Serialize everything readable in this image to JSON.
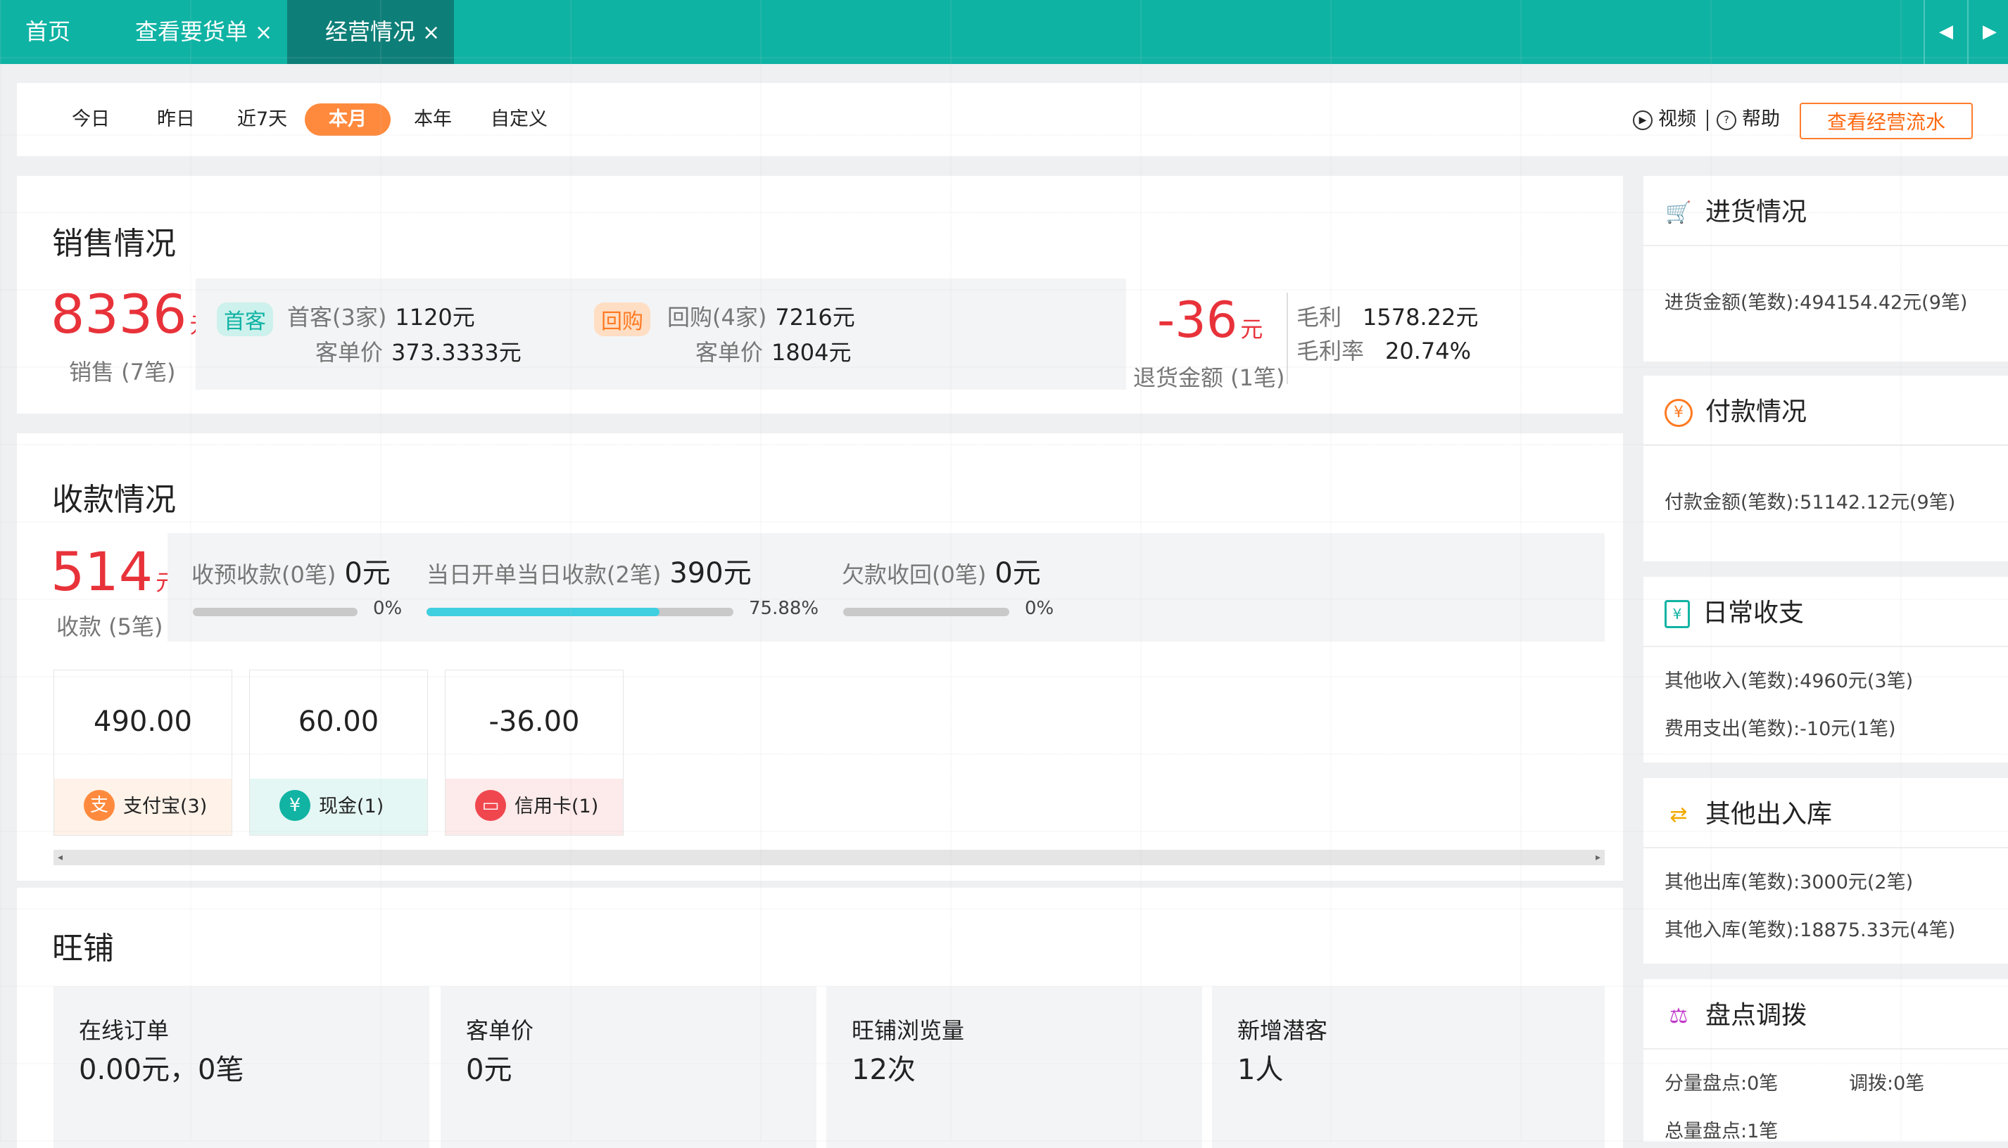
{
  "tabs": [
    {
      "label": "首页",
      "closable": false
    },
    {
      "label": "查看要货单",
      "closable": true
    },
    {
      "label": "经营情况",
      "closable": true,
      "active": true
    }
  ],
  "tab_close_glyph": "×",
  "nav": {
    "prev": "◀",
    "next": "▶"
  },
  "filters": {
    "periods": [
      "今日",
      "昨日",
      "近7天",
      "本月",
      "本年",
      "自定义"
    ],
    "selected": "本月",
    "video": "视频",
    "help": "帮助",
    "view_flow_button": "查看经营流水"
  },
  "sales": {
    "title": "销售情况",
    "amount": "8336",
    "unit": "元",
    "caption": "销售 (7笔)",
    "first": {
      "badge": "首客",
      "label": "首客(3家)",
      "value": "1120元",
      "avg_label": "客单价",
      "avg_value": "373.3333元"
    },
    "repeat": {
      "badge": "回购",
      "label": "回购(4家)",
      "value": "7216元",
      "avg_label": "客单价",
      "avg_value": "1804元"
    },
    "refund_amount": "-36",
    "refund_unit": "元",
    "refund_caption": "退货金额 (1笔)",
    "gross_profit_label": "毛利",
    "gross_profit_value": "1578.22元",
    "gross_margin_label": "毛利率",
    "gross_margin_value": "20.74%"
  },
  "collection": {
    "title": "收款情况",
    "amount": "514",
    "unit": "元",
    "caption": "收款 (5笔)",
    "progress": [
      {
        "label": "收预收款(0笔)",
        "value": "0元",
        "percent_text": "0%",
        "fraction": 0
      },
      {
        "label": "当日开单当日收款(2笔)",
        "value": "390元",
        "percent_text": "75.88%",
        "fraction": 0.7588
      },
      {
        "label": "欠款收回(0笔)",
        "value": "0元",
        "percent_text": "0%",
        "fraction": 0
      }
    ],
    "methods": [
      {
        "amount": "490.00",
        "name": "支付宝(3)",
        "icon": "alipay-icon",
        "glyph": "支",
        "color": "#ff8a3d",
        "bg": "#fff2e8"
      },
      {
        "amount": "60.00",
        "name": "现金(1)",
        "icon": "cash-icon",
        "glyph": "¥",
        "color": "#11b3a3",
        "bg": "#e4f7f4"
      },
      {
        "amount": "-36.00",
        "name": "信用卡(1)",
        "icon": "credit-card-icon",
        "glyph": "▭",
        "color": "#f0474f",
        "bg": "#fdeaea"
      }
    ]
  },
  "shop": {
    "title": "旺铺",
    "tiles": [
      {
        "label": "在线订单",
        "value": "0.00元，0笔"
      },
      {
        "label": "客单价",
        "value": "0元"
      },
      {
        "label": "旺铺浏览量",
        "value": "12次"
      },
      {
        "label": "新增潜客",
        "value": "1人"
      }
    ]
  },
  "side": {
    "purchase": {
      "title": "进货情况",
      "icon": "cart-icon",
      "lines": [
        "进货金额(笔数):494154.42元(9笔)"
      ]
    },
    "payment": {
      "title": "付款情况",
      "icon": "yen-circle-icon",
      "lines": [
        "付款金额(笔数):51142.12元(9笔)"
      ]
    },
    "daily": {
      "title": "日常收支",
      "icon": "ledger-icon",
      "lines": [
        "其他收入(笔数):4960元(3笔)",
        "费用支出(笔数):-10元(1笔)"
      ]
    },
    "stock": {
      "title": "其他出入库",
      "icon": "stock-in-out-icon",
      "lines": [
        "其他出库(笔数):3000元(2笔)",
        "其他入库(笔数):18875.33元(4笔)"
      ]
    },
    "inventory": {
      "title": "盘点调拨",
      "icon": "inventory-icon",
      "lines": [
        "分量盘点:0笔",
        "调拨:0笔",
        "总量盘点:1笔"
      ]
    }
  },
  "colors": {
    "teal": "#0fb3a4",
    "dark_teal": "#0e7f78",
    "orange": "#ff8a3d",
    "red": "#e8323a"
  }
}
